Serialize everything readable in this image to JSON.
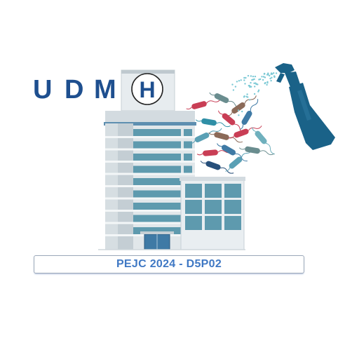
{
  "logo": {
    "letters": [
      "U",
      "D",
      "M"
    ],
    "sign_letter": "H",
    "banner_text": "PEJC 2024 - D5P02"
  },
  "colors": {
    "letters": "#1e4f8f",
    "banner_text": "#3f78c4",
    "building_window": "#5e9aae",
    "sprayer": "#1a6288",
    "spray_mist": "#7cc9d5"
  },
  "icons": [
    "hospital-building-icon",
    "spray-bottle-icon",
    "bacteria-icon"
  ]
}
